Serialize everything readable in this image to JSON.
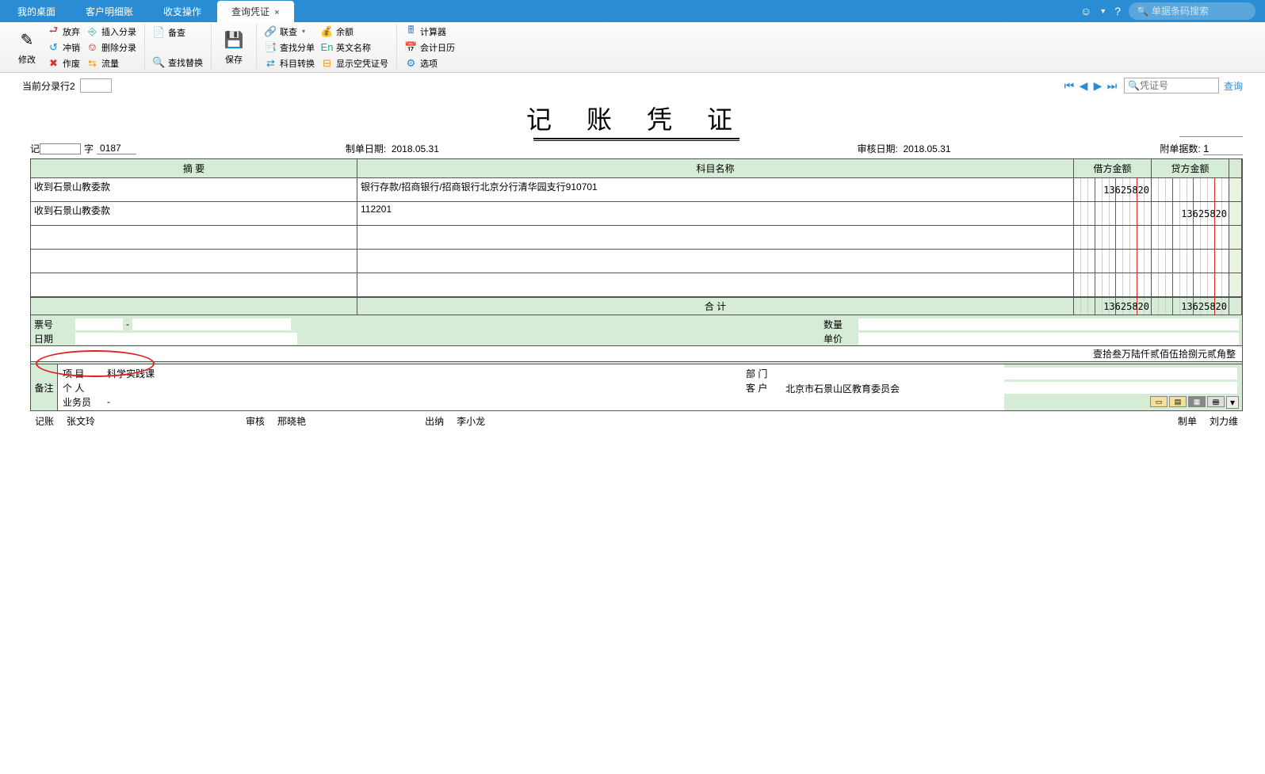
{
  "tabs": [
    {
      "label": "我的桌面"
    },
    {
      "label": "客户明细账"
    },
    {
      "label": "收支操作"
    },
    {
      "label": "查询凭证",
      "active": true
    }
  ],
  "search_placeholder": "单据条码搜索",
  "ribbon": {
    "modify": "修改",
    "abandon": "放弃",
    "insert_entry": "插入分录",
    "offset": "冲销",
    "delete_entry": "删除分录",
    "void": "作废",
    "flow": "流量",
    "backup": "备查",
    "find_replace": "查找替换",
    "save": "保存",
    "link_query": "联查",
    "balance": "余额",
    "find_sheet": "查找分单",
    "en_name": "英文名称",
    "account_switch": "科目转换",
    "show_empty": "显示空凭证号",
    "calculator": "计算器",
    "calendar": "会计日历",
    "options": "选项"
  },
  "subheader": {
    "current_row_label": "当前分录行2",
    "voucher_no_placeholder": "凭证号",
    "query": "查询"
  },
  "title": "记 账 凭 证",
  "meta": {
    "char_label": "记",
    "zi": "字",
    "num_suffix": "0187",
    "make_date_label": "制单日期:",
    "make_date": "2018.05.31",
    "audit_date_label": "审核日期:",
    "audit_date": "2018.05.31",
    "attach_label": "附单据数:",
    "attach_value": "1"
  },
  "columns": {
    "summary": "摘  要",
    "account": "科目名称",
    "debit": "借方金额",
    "credit": "贷方金额"
  },
  "rows": [
    {
      "summary": "收到石景山教委款",
      "account": "银行存款/招商银行/招商银行北京分行清华园支行910701",
      "debit": "13625820",
      "credit": ""
    },
    {
      "summary": "收到石景山教委款",
      "account": "112201",
      "debit": "",
      "credit": "13625820"
    },
    {
      "summary": "",
      "account": "",
      "debit": "",
      "credit": ""
    },
    {
      "summary": "",
      "account": "",
      "debit": "",
      "credit": ""
    },
    {
      "summary": "",
      "account": "",
      "debit": "",
      "credit": ""
    }
  ],
  "total": {
    "label": "合  计",
    "debit": "13625820",
    "credit": "13625820"
  },
  "detail": {
    "ticket_label": "票号",
    "ticket_sep": "-",
    "date_label": "日期",
    "qty_label": "数量",
    "price_label": "单价",
    "amount_words": "壹拾叁万陆仟贰佰伍拾捌元贰角整"
  },
  "remark": {
    "label": "备注",
    "project_label": "项  目",
    "project_value": "科学实践课",
    "dept_label": "部  门",
    "dept_value": "",
    "person_label": "个  人",
    "person_value": "",
    "customer_label": "客  户",
    "customer_value": "北京市石景山区教育委员会",
    "bizman_label": "业务员",
    "bizman_sep": "-"
  },
  "signatures": {
    "book_label": "记账",
    "book_value": "张文玲",
    "audit_label": "审核",
    "audit_value": "邢晓艳",
    "cashier_label": "出纳",
    "cashier_value": "李小龙",
    "maker_label": "制单",
    "maker_value": "刘力维"
  }
}
